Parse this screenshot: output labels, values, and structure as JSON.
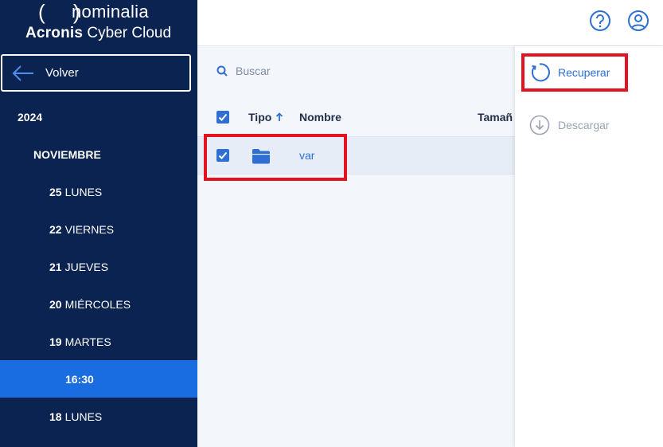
{
  "brand": {
    "parens": "( )",
    "name": "nominalia",
    "product_bold": "Acronis",
    "product_light": " Cyber Cloud"
  },
  "sidebar": {
    "back_label": "Volver",
    "items": [
      {
        "bold": "2024",
        "text": ""
      },
      {
        "bold": "NOVIEMBRE",
        "text": ""
      },
      {
        "bold": "25",
        "text": "LUNES"
      },
      {
        "bold": "22",
        "text": "VIERNES"
      },
      {
        "bold": "21",
        "text": "JUEVES"
      },
      {
        "bold": "20",
        "text": "MIÉRCOLES"
      },
      {
        "bold": "19",
        "text": "MARTES"
      },
      {
        "bold": "16:30",
        "text": ""
      },
      {
        "bold": "18",
        "text": "LUNES"
      }
    ]
  },
  "topbar": {
    "help_icon": "question-circle-icon",
    "account_icon": "user-circle-icon"
  },
  "main": {
    "search_placeholder": "Buscar",
    "columns": {
      "tipo": "Tipo",
      "nombre": "Nombre",
      "tamano": "Tamañ"
    },
    "rows": [
      {
        "name": "var",
        "type": "folder",
        "checked": true
      }
    ]
  },
  "panel": {
    "recover_label": "Recuperar",
    "download_label": "Descargar"
  },
  "colors": {
    "sidebar_bg": "#0b2350",
    "active_item": "#1a6de0",
    "accent": "#2f6fd3",
    "highlight": "#e3141f"
  }
}
